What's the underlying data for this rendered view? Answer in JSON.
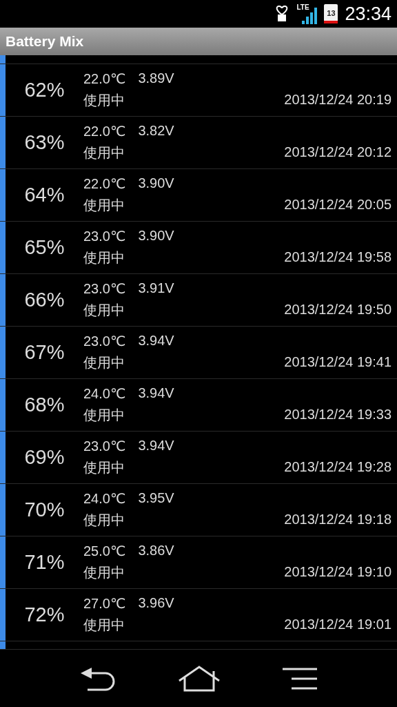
{
  "status_bar": {
    "network": "LTE",
    "battery": "13",
    "time": "23:34"
  },
  "app_bar": {
    "title": "Battery Mix"
  },
  "rows": [
    {
      "percent": "62%",
      "temperature": "22.0℃",
      "voltage": "3.89V",
      "status": "使用中",
      "datetime": "2013/12/24 20:19"
    },
    {
      "percent": "63%",
      "temperature": "22.0℃",
      "voltage": "3.82V",
      "status": "使用中",
      "datetime": "2013/12/24 20:12"
    },
    {
      "percent": "64%",
      "temperature": "22.0℃",
      "voltage": "3.90V",
      "status": "使用中",
      "datetime": "2013/12/24 20:05"
    },
    {
      "percent": "65%",
      "temperature": "23.0℃",
      "voltage": "3.90V",
      "status": "使用中",
      "datetime": "2013/12/24 19:58"
    },
    {
      "percent": "66%",
      "temperature": "23.0℃",
      "voltage": "3.91V",
      "status": "使用中",
      "datetime": "2013/12/24 19:50"
    },
    {
      "percent": "67%",
      "temperature": "23.0℃",
      "voltage": "3.94V",
      "status": "使用中",
      "datetime": "2013/12/24 19:41"
    },
    {
      "percent": "68%",
      "temperature": "24.0℃",
      "voltage": "3.94V",
      "status": "使用中",
      "datetime": "2013/12/24 19:33"
    },
    {
      "percent": "69%",
      "temperature": "23.0℃",
      "voltage": "3.94V",
      "status": "使用中",
      "datetime": "2013/12/24 19:28"
    },
    {
      "percent": "70%",
      "temperature": "24.0℃",
      "voltage": "3.95V",
      "status": "使用中",
      "datetime": "2013/12/24 19:18"
    },
    {
      "percent": "71%",
      "temperature": "25.0℃",
      "voltage": "3.86V",
      "status": "使用中",
      "datetime": "2013/12/24 19:10"
    },
    {
      "percent": "72%",
      "temperature": "27.0℃",
      "voltage": "3.96V",
      "status": "使用中",
      "datetime": "2013/12/24 19:01"
    }
  ]
}
